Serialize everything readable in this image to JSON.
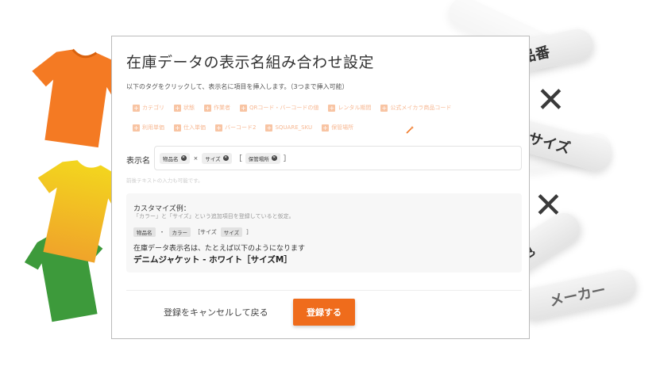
{
  "decor": {
    "pills": [
      "品番",
      "サイズ",
      "色",
      "メーカー"
    ],
    "cross": "✕"
  },
  "panel": {
    "title": "在庫データの表示名組み合わせ設定",
    "instruction": "以下のタグをクリックして、表示名に項目を挿入します。（3つまで挿入可能）",
    "tags_row1": [
      "カテゴリ",
      "状態",
      "作業者",
      "QRコード・バーコードの値",
      "レンタル期間",
      "公式メイカラ商品コード"
    ],
    "tags_row2": [
      "利用単価",
      "仕入単価",
      "バーコード2",
      "SQUARE_SKU",
      "保管場所"
    ],
    "display_name_label": "表示名",
    "chips": [
      "物品名",
      "サイズ",
      "保管場所"
    ],
    "chip_separator": "×",
    "bracket_open": "［",
    "bracket_close": "］",
    "hint": "前後テキストの入力も可能です。",
    "example": {
      "title": "カスタマイズ例：",
      "description": "「カラー」と「サイズ」という追加項目を登録していると仮定。",
      "chip1": "物品名",
      "dot": "・",
      "chip2": "カラー",
      "bracket_text": "［サイズ",
      "chip3": "サイズ",
      "close": "］",
      "line": "在庫データ表示名は、たとえば以下のようになります",
      "result": "デニムジャケット - ホワイト［サイズM］"
    },
    "cancel_label": "登録をキャンセルして戻る",
    "submit_label": "登録する"
  }
}
